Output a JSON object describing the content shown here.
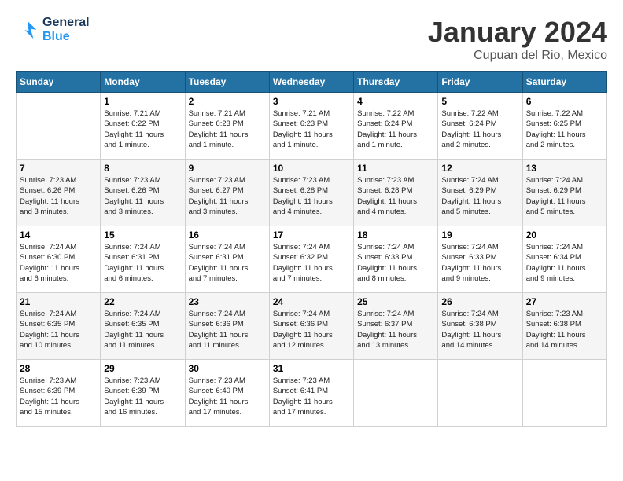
{
  "header": {
    "logo_line1": "General",
    "logo_line2": "Blue",
    "month": "January 2024",
    "location": "Cupuan del Rio, Mexico"
  },
  "days_of_week": [
    "Sunday",
    "Monday",
    "Tuesday",
    "Wednesday",
    "Thursday",
    "Friday",
    "Saturday"
  ],
  "weeks": [
    [
      {
        "num": "",
        "info": ""
      },
      {
        "num": "1",
        "info": "Sunrise: 7:21 AM\nSunset: 6:22 PM\nDaylight: 11 hours\nand 1 minute."
      },
      {
        "num": "2",
        "info": "Sunrise: 7:21 AM\nSunset: 6:23 PM\nDaylight: 11 hours\nand 1 minute."
      },
      {
        "num": "3",
        "info": "Sunrise: 7:21 AM\nSunset: 6:23 PM\nDaylight: 11 hours\nand 1 minute."
      },
      {
        "num": "4",
        "info": "Sunrise: 7:22 AM\nSunset: 6:24 PM\nDaylight: 11 hours\nand 1 minute."
      },
      {
        "num": "5",
        "info": "Sunrise: 7:22 AM\nSunset: 6:24 PM\nDaylight: 11 hours\nand 2 minutes."
      },
      {
        "num": "6",
        "info": "Sunrise: 7:22 AM\nSunset: 6:25 PM\nDaylight: 11 hours\nand 2 minutes."
      }
    ],
    [
      {
        "num": "7",
        "info": "Sunrise: 7:23 AM\nSunset: 6:26 PM\nDaylight: 11 hours\nand 3 minutes."
      },
      {
        "num": "8",
        "info": "Sunrise: 7:23 AM\nSunset: 6:26 PM\nDaylight: 11 hours\nand 3 minutes."
      },
      {
        "num": "9",
        "info": "Sunrise: 7:23 AM\nSunset: 6:27 PM\nDaylight: 11 hours\nand 3 minutes."
      },
      {
        "num": "10",
        "info": "Sunrise: 7:23 AM\nSunset: 6:28 PM\nDaylight: 11 hours\nand 4 minutes."
      },
      {
        "num": "11",
        "info": "Sunrise: 7:23 AM\nSunset: 6:28 PM\nDaylight: 11 hours\nand 4 minutes."
      },
      {
        "num": "12",
        "info": "Sunrise: 7:24 AM\nSunset: 6:29 PM\nDaylight: 11 hours\nand 5 minutes."
      },
      {
        "num": "13",
        "info": "Sunrise: 7:24 AM\nSunset: 6:29 PM\nDaylight: 11 hours\nand 5 minutes."
      }
    ],
    [
      {
        "num": "14",
        "info": "Sunrise: 7:24 AM\nSunset: 6:30 PM\nDaylight: 11 hours\nand 6 minutes."
      },
      {
        "num": "15",
        "info": "Sunrise: 7:24 AM\nSunset: 6:31 PM\nDaylight: 11 hours\nand 6 minutes."
      },
      {
        "num": "16",
        "info": "Sunrise: 7:24 AM\nSunset: 6:31 PM\nDaylight: 11 hours\nand 7 minutes."
      },
      {
        "num": "17",
        "info": "Sunrise: 7:24 AM\nSunset: 6:32 PM\nDaylight: 11 hours\nand 7 minutes."
      },
      {
        "num": "18",
        "info": "Sunrise: 7:24 AM\nSunset: 6:33 PM\nDaylight: 11 hours\nand 8 minutes."
      },
      {
        "num": "19",
        "info": "Sunrise: 7:24 AM\nSunset: 6:33 PM\nDaylight: 11 hours\nand 9 minutes."
      },
      {
        "num": "20",
        "info": "Sunrise: 7:24 AM\nSunset: 6:34 PM\nDaylight: 11 hours\nand 9 minutes."
      }
    ],
    [
      {
        "num": "21",
        "info": "Sunrise: 7:24 AM\nSunset: 6:35 PM\nDaylight: 11 hours\nand 10 minutes."
      },
      {
        "num": "22",
        "info": "Sunrise: 7:24 AM\nSunset: 6:35 PM\nDaylight: 11 hours\nand 11 minutes."
      },
      {
        "num": "23",
        "info": "Sunrise: 7:24 AM\nSunset: 6:36 PM\nDaylight: 11 hours\nand 11 minutes."
      },
      {
        "num": "24",
        "info": "Sunrise: 7:24 AM\nSunset: 6:36 PM\nDaylight: 11 hours\nand 12 minutes."
      },
      {
        "num": "25",
        "info": "Sunrise: 7:24 AM\nSunset: 6:37 PM\nDaylight: 11 hours\nand 13 minutes."
      },
      {
        "num": "26",
        "info": "Sunrise: 7:24 AM\nSunset: 6:38 PM\nDaylight: 11 hours\nand 14 minutes."
      },
      {
        "num": "27",
        "info": "Sunrise: 7:23 AM\nSunset: 6:38 PM\nDaylight: 11 hours\nand 14 minutes."
      }
    ],
    [
      {
        "num": "28",
        "info": "Sunrise: 7:23 AM\nSunset: 6:39 PM\nDaylight: 11 hours\nand 15 minutes."
      },
      {
        "num": "29",
        "info": "Sunrise: 7:23 AM\nSunset: 6:39 PM\nDaylight: 11 hours\nand 16 minutes."
      },
      {
        "num": "30",
        "info": "Sunrise: 7:23 AM\nSunset: 6:40 PM\nDaylight: 11 hours\nand 17 minutes."
      },
      {
        "num": "31",
        "info": "Sunrise: 7:23 AM\nSunset: 6:41 PM\nDaylight: 11 hours\nand 17 minutes."
      },
      {
        "num": "",
        "info": ""
      },
      {
        "num": "",
        "info": ""
      },
      {
        "num": "",
        "info": ""
      }
    ]
  ]
}
